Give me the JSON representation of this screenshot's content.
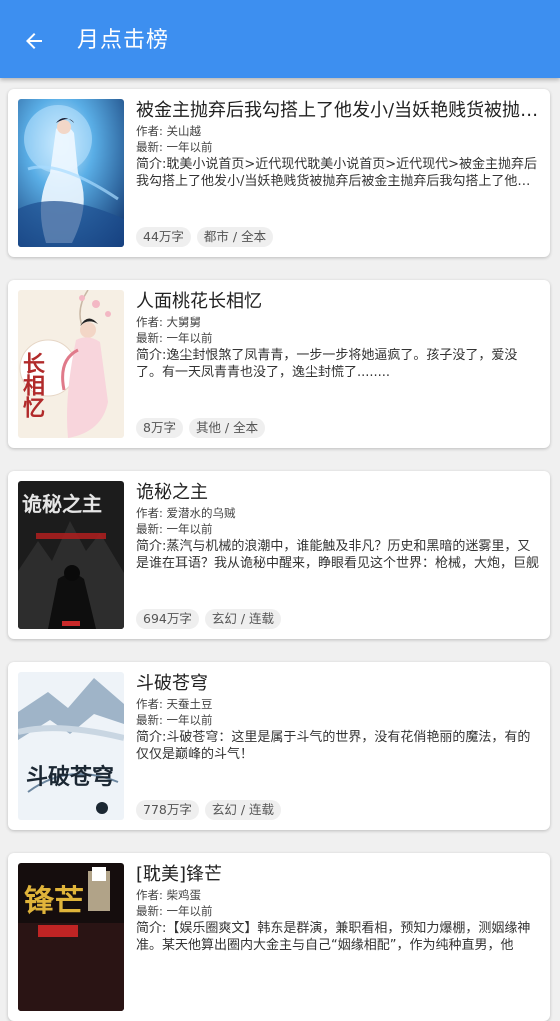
{
  "header": {
    "title": "月点击榜",
    "back_icon": "arrow-left-icon"
  },
  "books": [
    {
      "title": "被金主抛弃后我勾搭上了他发小/当妖艳贱货被抛弃后被金主抛弃后我勾搭上了他发小",
      "author": "作者: 关山越",
      "updated": "最新: 一年以前",
      "intro": "简介:耽美小说首页>近代现代耽美小说首页>近代现代>被金主抛弃后我勾搭上了他发小/当妖艳贱货被抛弃后被金主抛弃后我勾搭上了他发小",
      "words": "44万字",
      "category": "都市 / 全本"
    },
    {
      "title": "人面桃花长相忆",
      "author": "作者: 大舅舅",
      "updated": "最新: 一年以前",
      "intro": "简介:逸尘封恨煞了凤青青，一步一步将她逼疯了。孩子没了，爱没了。有一天凤青青也没了，逸尘封慌了........",
      "words": "8万字",
      "category": "其他 / 全本",
      "cover_text": "长相忆"
    },
    {
      "title": "诡秘之主",
      "author": "作者: 爱潜水的乌贼",
      "updated": "最新: 一年以前",
      "intro": "简介:蒸汽与机械的浪潮中，谁能触及非凡？历史和黑暗的迷雾里，又是谁在耳语？我从诡秘中醒来，睁眼看见这个世界：枪械，大炮，巨舰",
      "words": "694万字",
      "category": "玄幻 / 连载",
      "cover_text": "诡秘之主"
    },
    {
      "title": "斗破苍穹",
      "author": "作者: 天蚕土豆",
      "updated": "最新: 一年以前",
      "intro": "简介:斗破苍穹：这里是属于斗气的世界，没有花俏艳丽的魔法，有的仅仅是巅峰的斗气！",
      "words": "778万字",
      "category": "玄幻 / 连载",
      "cover_text": "斗破苍穹"
    },
    {
      "title": "[耽美]锋芒",
      "author": "作者: 柴鸡蛋",
      "updated": "最新: 一年以前",
      "intro": "简介:【娱乐圈爽文】韩东是群演，兼职看相，预知力爆棚，测姻缘神准。某天他算出圈内大金主与自己“姻缘相配”，作为纯种直男，他",
      "words": "",
      "category": "",
      "cover_text": "锋芒"
    }
  ]
}
